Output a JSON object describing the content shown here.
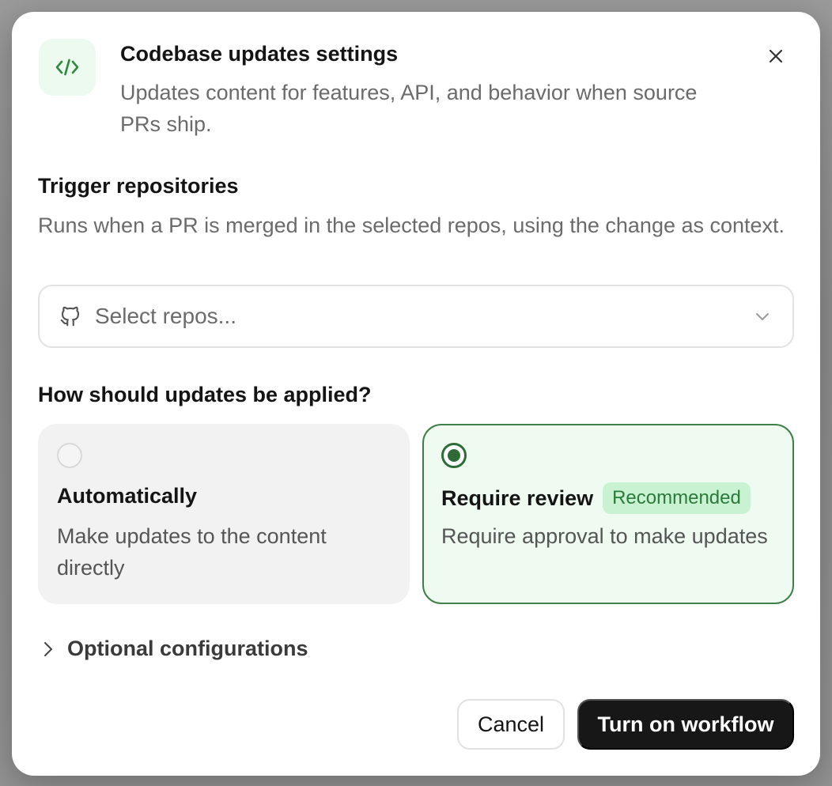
{
  "dialog": {
    "title": "Codebase updates settings",
    "subtitle": "Updates content for features, API, and behavior when source PRs ship.",
    "header_icon": "code-icon",
    "close_icon": "close-icon"
  },
  "trigger": {
    "title": "Trigger repositories",
    "description": "Runs when a PR is merged in the selected repos, using the change as context.",
    "select_placeholder": "Select repos...",
    "select_icon": "github-icon",
    "chevron_icon": "chevron-down-icon"
  },
  "apply": {
    "title": "How should updates be applied?",
    "options": [
      {
        "title": "Automatically",
        "description": "Make updates to the content directly",
        "selected": false
      },
      {
        "title": "Require review",
        "badge": "Recommended",
        "description": "Require approval to make updates",
        "selected": true
      }
    ]
  },
  "optional": {
    "label": "Optional configurations",
    "icon": "chevron-right-icon"
  },
  "footer": {
    "cancel_label": "Cancel",
    "confirm_label": "Turn on workflow"
  },
  "colors": {
    "accent_green": "#2f6b37",
    "badge_bg": "#c9f2d2",
    "primary_button": "#171717"
  }
}
